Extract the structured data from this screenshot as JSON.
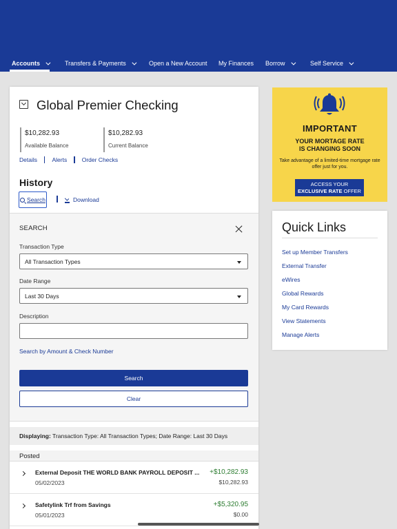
{
  "nav": {
    "items": [
      {
        "label": "Accounts",
        "chevron": true
      },
      {
        "label": "Transfers & Payments",
        "chevron": true
      },
      {
        "label": "Open a New Account",
        "chevron": false
      },
      {
        "label": "My Finances",
        "chevron": false
      },
      {
        "label": "Borrow",
        "chevron": true
      },
      {
        "label": "Self Service",
        "chevron": true
      }
    ]
  },
  "account": {
    "title": "Global Premier Checking",
    "available_balance": "$10,282.93",
    "available_label": "Available Balance",
    "current_balance": "$10,282.93",
    "current_label": "Current Balance",
    "links": [
      "Details",
      "Alerts",
      "Order Checks"
    ]
  },
  "history": {
    "title": "History",
    "search_tab": "Search",
    "download": "Download"
  },
  "search_panel": {
    "title": "SEARCH",
    "transaction_type_label": "Transaction Type",
    "transaction_type_value": "All Transaction Types",
    "date_range_label": "Date Range",
    "date_range_value": "Last 30 Days",
    "description_label": "Description",
    "description_value": "",
    "advanced_link": "Search by Amount & Check Number",
    "search_button": "Search",
    "clear_button": "Clear"
  },
  "displaying": {
    "label": "Displaying:",
    "text": "Transaction Type: All Transaction Types; Date Range: Last 30 Days"
  },
  "posted": {
    "header": "Posted",
    "transactions": [
      {
        "description": "External Deposit THE WORLD BANK PAYROLL DEPOSIT ...",
        "date": "05/02/2023",
        "amount": "+$10,282.93",
        "balance": "$10,282.93"
      },
      {
        "description": "Safetylink Trf from Savings",
        "date": "05/01/2023",
        "amount": "+$5,320.95",
        "balance": "$0.00"
      }
    ]
  },
  "promo": {
    "heading": "IMPORTANT",
    "subheading_1": "YOUR MORTAGE RATE",
    "subheading_2": "IS CHANGING SOON",
    "body": "Take advantage of a limited-time mortgage rate offer just for you.",
    "cta_1": "ACCESS YOUR",
    "cta_2_bold": "EXCLUSIVE RATE",
    "cta_2_rest": "OFFER"
  },
  "quick_links": {
    "title": "Quick Links",
    "links": [
      "Set up Member Transfers",
      "External Transfer",
      "eWires",
      "Global Rewards",
      "My Card Rewards",
      "View Statements",
      "Manage Alerts"
    ]
  },
  "colors": {
    "brand_blue": "#1a3a96",
    "promo_yellow": "#f7d54a",
    "credit_green": "#2e7d32"
  }
}
